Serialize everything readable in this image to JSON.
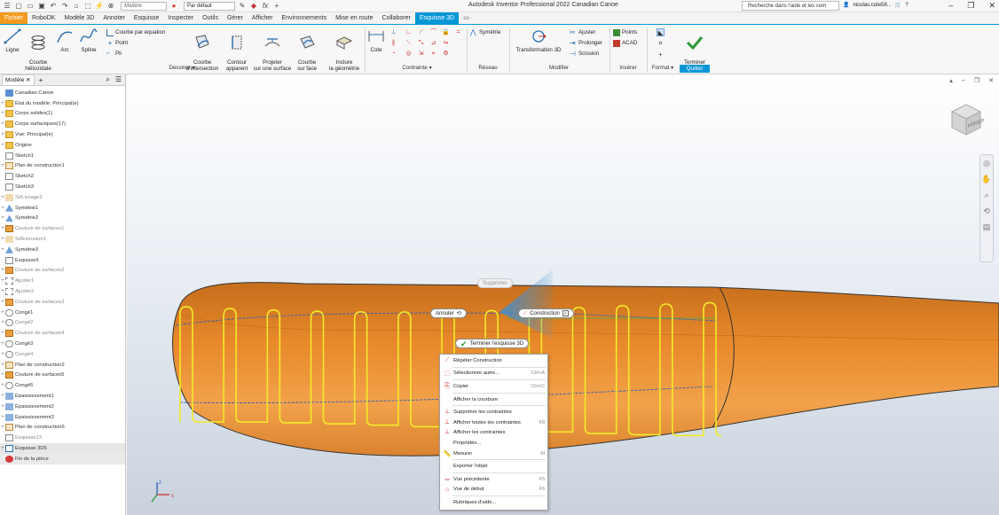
{
  "title_bar": {
    "material_placeholder": "Matière",
    "appearance": "Par défaut",
    "app_title": "Autodesk Inventor Professional 2022   Canadian Canoe",
    "help_search": "Recherche dans l'aide et les com",
    "user": "nicolas.cote58...",
    "help_label": "?"
  },
  "tabs": [
    "Fichier",
    "RoboDK",
    "Modèle 3D",
    "Annoter",
    "Esquisse",
    "Inspecter",
    "Outils",
    "Gérer",
    "Afficher",
    "Environnements",
    "Mise en route",
    "Collaborer",
    "Esquisse 3D",
    "▭·"
  ],
  "ribbon": {
    "ligne": "Ligne",
    "courbe_helicoidale": "Courbe\nhélicoïdale",
    "arc": "Arc",
    "spline": "Spline",
    "courbe_equation": "Courbe par équation",
    "point": "Point",
    "pli": "Pli",
    "courbe_intersection": "Courbe\nd'intersection",
    "contour_apparent": "Contour\napparent",
    "projeter_surface": "Projeter\nsur une surface",
    "courbe_face": "Courbe\nsur face",
    "inclure_geometrie": "Inclure\nla géométrie",
    "cote": "Cote",
    "symetrie": "Symétrie",
    "transformation_3d": "Transformation 3D",
    "ajuster": "Ajuster",
    "prolonger": "Prolonger",
    "scission": "Scission",
    "points": "Points",
    "acad": "ACAD",
    "terminer": "Terminer\nl'esquisse",
    "grp_dessiner": "Dessiner ▾",
    "grp_contrainte": "Contrainte ▾",
    "grp_reseau": "Réseau",
    "grp_modifier": "Modifier",
    "grp_inserer": "Insérer",
    "grp_format": "Format ▾",
    "grp_quitter": "Quitter"
  },
  "browser": {
    "tab_label": "Modèle",
    "items": [
      {
        "label": "Canadian Canoe",
        "icon": "part",
        "dim": false
      },
      {
        "label": "État du modèle: Principal(e)",
        "icon": "folder",
        "dim": false
      },
      {
        "label": "Corps solides(1)",
        "icon": "folder",
        "dim": false
      },
      {
        "label": "Corps surfaciques(17)",
        "icon": "folder",
        "dim": false
      },
      {
        "label": "Vue: Principal(e)",
        "icon": "folder",
        "dim": false
      },
      {
        "label": "Origine",
        "icon": "folder",
        "dim": false
      },
      {
        "label": "Sketch1",
        "icon": "sketch",
        "dim": false
      },
      {
        "label": "Plan de construction1",
        "icon": "plane",
        "dim": false
      },
      {
        "label": "Sketch2",
        "icon": "sketch",
        "dim": false
      },
      {
        "label": "Sketch3",
        "icon": "sketch",
        "dim": false
      },
      {
        "label": "SrfLissage2",
        "icon": "surface",
        "dim": true
      },
      {
        "label": "Symétrie1",
        "icon": "mirror",
        "dim": false
      },
      {
        "label": "Symétrie2",
        "icon": "mirror",
        "dim": false
      },
      {
        "label": "Couture de surfaces1",
        "icon": "stitch",
        "dim": true
      },
      {
        "label": "SrfExtrusion1",
        "icon": "surface",
        "dim": true
      },
      {
        "label": "Symétrie3",
        "icon": "mirror",
        "dim": false
      },
      {
        "label": "Esquisse5",
        "icon": "sketch",
        "dim": false
      },
      {
        "label": "Couture de surfaces2",
        "icon": "stitch",
        "dim": true
      },
      {
        "label": "Ajuster1",
        "icon": "trim",
        "dim": true
      },
      {
        "label": "Ajuster2",
        "icon": "trim",
        "dim": true
      },
      {
        "label": "Couture de surfaces3",
        "icon": "stitch",
        "dim": true
      },
      {
        "label": "Congé1",
        "icon": "fillet",
        "dim": false
      },
      {
        "label": "Congé2",
        "icon": "fillet",
        "dim": true
      },
      {
        "label": "Couture de surfaces4",
        "icon": "stitch",
        "dim": true
      },
      {
        "label": "Congé3",
        "icon": "fillet",
        "dim": false
      },
      {
        "label": "Congé4",
        "icon": "fillet",
        "dim": true
      },
      {
        "label": "Plan de construction2",
        "icon": "plane",
        "dim": false
      },
      {
        "label": "Couture de surfaces5",
        "icon": "stitch",
        "dim": false
      },
      {
        "label": "Congé5",
        "icon": "fillet",
        "dim": false
      },
      {
        "label": "Épaississement1",
        "icon": "thicken",
        "dim": false
      },
      {
        "label": "Épaississement2",
        "icon": "thicken",
        "dim": false
      },
      {
        "label": "Épaississement3",
        "icon": "thicken",
        "dim": false
      },
      {
        "label": "Plan de construction6",
        "icon": "plane",
        "dim": false
      },
      {
        "label": "Esquisse13",
        "icon": "sketch",
        "dim": true
      },
      {
        "label": "Esquisse 3D5",
        "icon": "sketch3d",
        "dim": false,
        "selected": true
      },
      {
        "label": "Fin de la pièce",
        "icon": "end",
        "dim": false,
        "endpart": true
      }
    ]
  },
  "viewport": {
    "viewcube_label": "ARRIERE",
    "floating": {
      "supprimer": "Supprimer",
      "annuler": "Annuler",
      "construction": "Construction",
      "terminer": "Terminer l'esquisse 3D"
    }
  },
  "context_menu": {
    "items": [
      {
        "label": "Répéter Construction",
        "shortcut": "",
        "icon": "construction-icon"
      },
      {
        "sep": true
      },
      {
        "label": "Sélectionner autre...",
        "shortcut": "Ctrl+A",
        "icon": "select-icon"
      },
      {
        "sep": true
      },
      {
        "label": "Copier",
        "shortcut": "Ctrl+C",
        "icon": "copy-icon"
      },
      {
        "sep": true
      },
      {
        "label": "Afficher la courbure",
        "shortcut": "",
        "icon": ""
      },
      {
        "sep": true
      },
      {
        "label": "Supprimer les contraintes",
        "shortcut": "",
        "icon": "constraint-delete-icon"
      },
      {
        "label": "Afficher toutes les contraintes",
        "shortcut": "F8",
        "icon": "constraint-show-icon"
      },
      {
        "label": "Afficher les contraintes",
        "shortcut": "",
        "icon": "constraint-show-icon"
      },
      {
        "label": "Propriétés...",
        "shortcut": "",
        "icon": ""
      },
      {
        "label": "Mesurer",
        "shortcut": "M",
        "icon": "measure-icon"
      },
      {
        "sep": true
      },
      {
        "label": "Exporter l'objet",
        "shortcut": "",
        "icon": ""
      },
      {
        "sep": true
      },
      {
        "label": "Vue précédente",
        "shortcut": "F5",
        "icon": "prev-view-icon"
      },
      {
        "label": "Vue de début",
        "shortcut": "F6",
        "icon": "home-view-icon"
      },
      {
        "sep": true
      },
      {
        "label": "Rubriques d'aide...",
        "shortcut": "",
        "icon": ""
      }
    ]
  },
  "colors": {
    "accent": "#0696d7",
    "file_tab": "#f29a1f",
    "hull": "#e8892b",
    "spring": "#f2ea2a"
  }
}
